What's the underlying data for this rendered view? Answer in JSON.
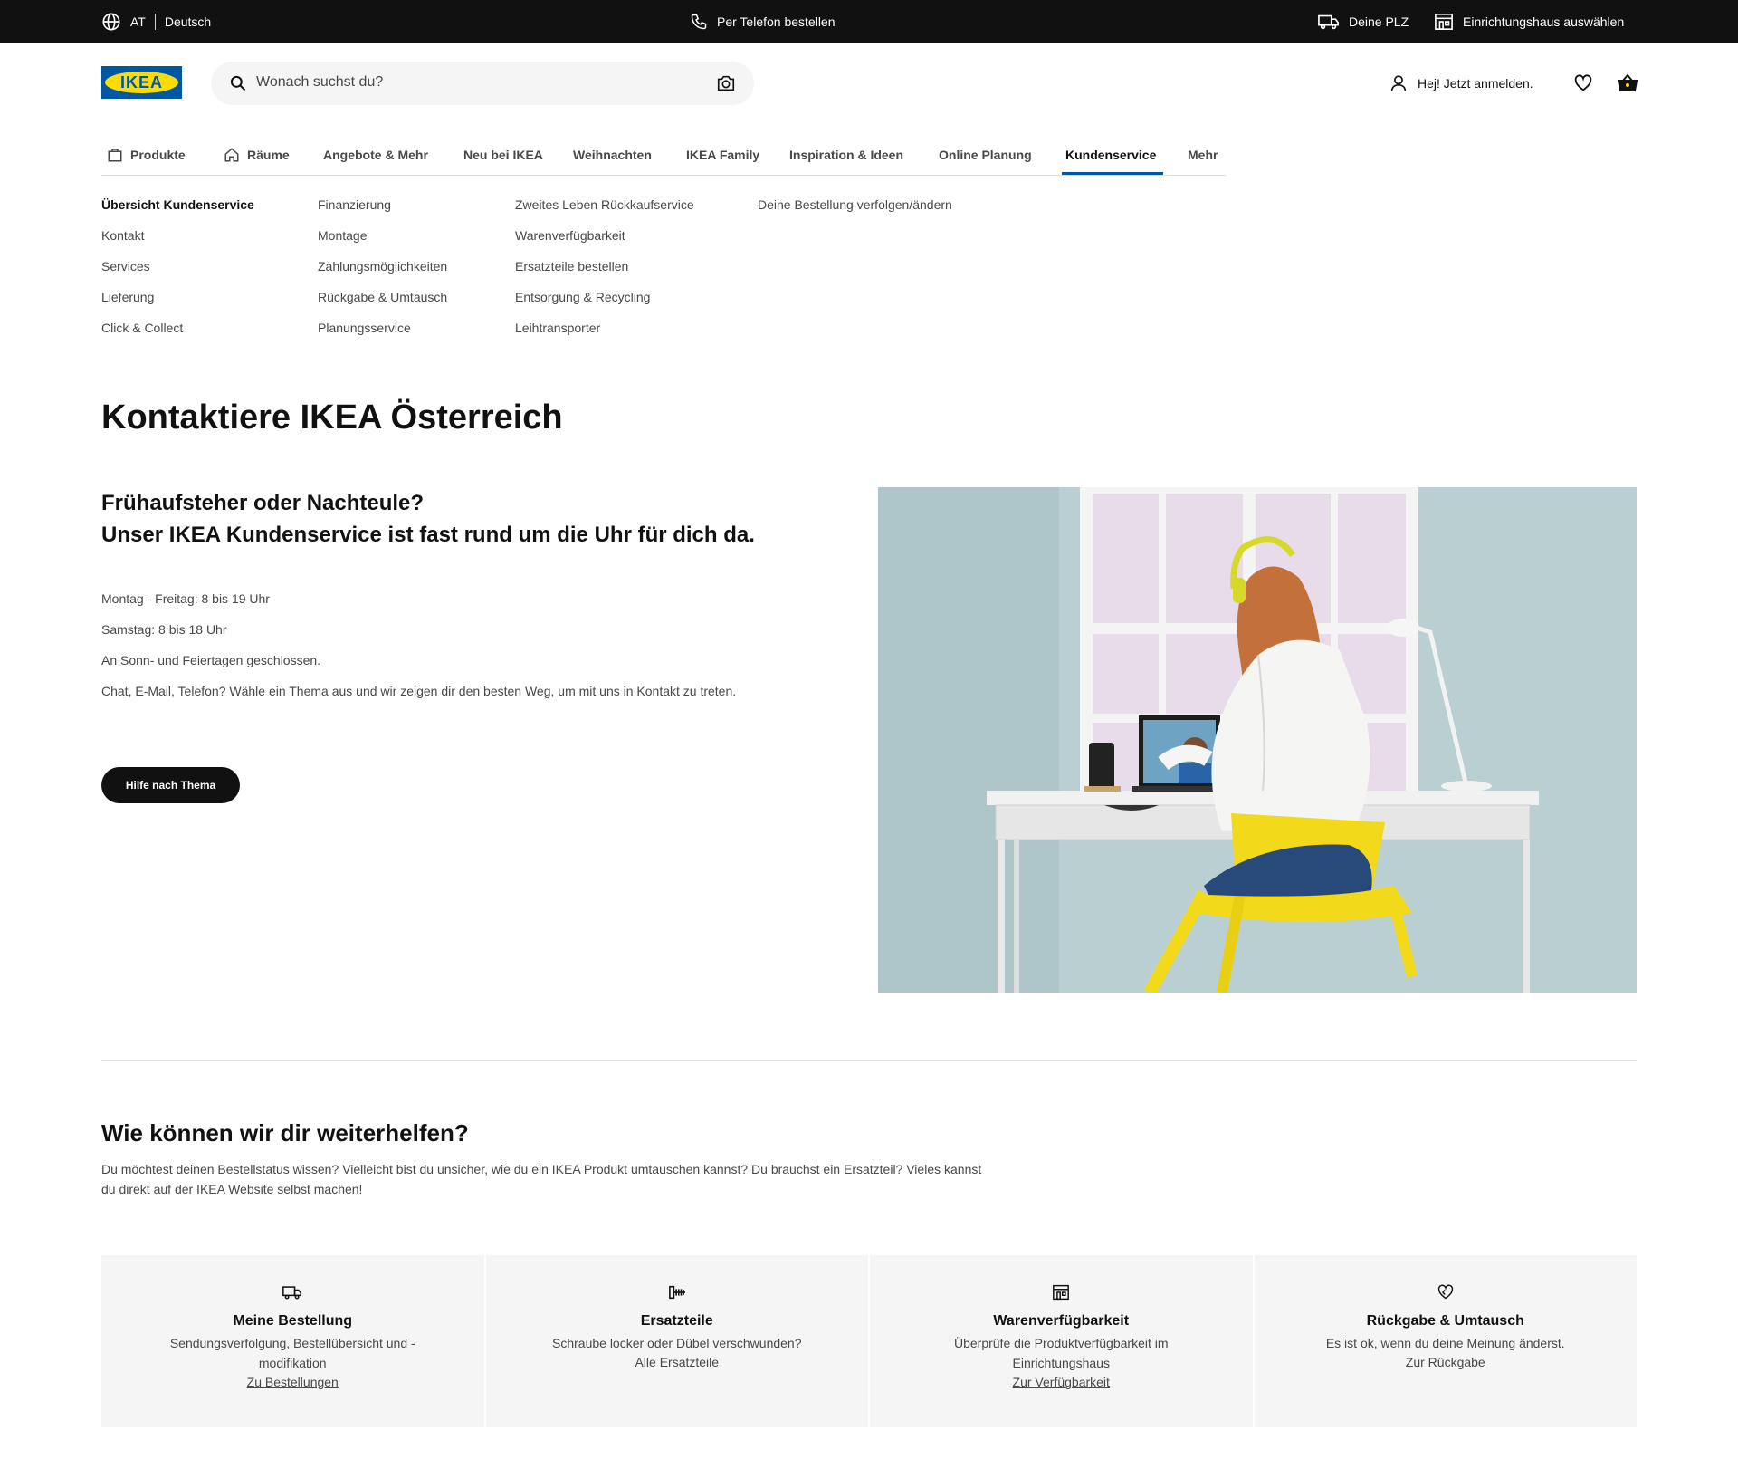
{
  "topbar": {
    "country": "AT",
    "language": "Deutsch",
    "phone": "Per Telefon bestellen",
    "zip": "Deine PLZ",
    "store": "Einrichtungshaus auswählen"
  },
  "header": {
    "logo_text": "IKEA",
    "search_placeholder": "Wonach suchst du?",
    "login": "Hej! Jetzt anmelden."
  },
  "nav": {
    "tabs": [
      {
        "label": "Produkte",
        "icon": "shopping-bag-icon"
      },
      {
        "label": "Räume",
        "icon": "home-icon"
      },
      {
        "label": "Angebote & Mehr"
      },
      {
        "label": "Neu bei IKEA"
      },
      {
        "label": "Weihnachten"
      },
      {
        "label": "IKEA Family"
      },
      {
        "label": "Inspiration & Ideen"
      },
      {
        "label": "Online Planung"
      },
      {
        "label": "Kundenservice",
        "active": true
      },
      {
        "label": "Mehr"
      }
    ]
  },
  "submenu": {
    "col1": [
      "Übersicht Kundenservice",
      "Kontakt",
      "Services",
      "Lieferung",
      "Click & Collect"
    ],
    "col2": [
      "Finanzierung",
      "Montage",
      "Zahlungsmöglichkeiten",
      "Rückgabe & Umtausch",
      "Planungsservice"
    ],
    "col3": [
      "Zweites Leben Rückkaufservice",
      "Warenverfügbarkeit",
      "Ersatzteile bestellen",
      "Entsorgung & Recycling",
      "Leihtransporter"
    ],
    "col4": [
      "Deine Bestellung verfolgen/ändern"
    ]
  },
  "main": {
    "title": "Kontaktiere IKEA Österreich",
    "headline1": "Frühaufsteher oder Nachteule?",
    "headline2": "Unser IKEA Kundenservice ist fast rund um die Uhr für dich da.",
    "hours": [
      "Montag - Freitag: 8 bis 19 Uhr",
      "Samstag: 8 bis 18 Uhr",
      "An Sonn- und Feiertagen geschlossen.",
      "Chat, E-Mail, Telefon? Wähle ein Thema aus und wir zeigen dir den besten Weg, um mit uns in Kontakt zu treten."
    ],
    "button": "Hilfe nach Thema"
  },
  "help": {
    "title": "Wie können wir dir weiterhelfen?",
    "text": "Du möchtest deinen Bestellstatus wissen? Vielleicht bist du unsicher, wie du ein IKEA Produkt umtauschen kannst? Du brauchst ein Ersatzteil? Vieles kannst du direkt auf der IKEA Website selbst machen!",
    "cards": [
      {
        "icon": "truck-icon",
        "title": "Meine Bestellung",
        "desc": "Sendungsverfolgung, Bestellübersicht und -modifikation",
        "link": "Zu Bestellungen"
      },
      {
        "icon": "screw-icon",
        "title": "Ersatzteile",
        "desc": "Schraube locker oder Dübel verschwunden?",
        "link": "Alle Ersatzteile"
      },
      {
        "icon": "store-icon",
        "title": "Warenverfügbarkeit",
        "desc": "Überprüfe die Produktverfügbarkeit im Einrichtungshaus",
        "link": "Zur Verfügbarkeit"
      },
      {
        "icon": "return-heart-icon",
        "title": "Rückgabe & Umtausch",
        "desc": "Es ist ok, wenn du deine Meinung änderst.",
        "link": "Zur Rückgabe"
      }
    ]
  },
  "colors": {
    "brand_blue": "#0058a3",
    "brand_yellow": "#ffdb00",
    "dark": "#111111"
  }
}
